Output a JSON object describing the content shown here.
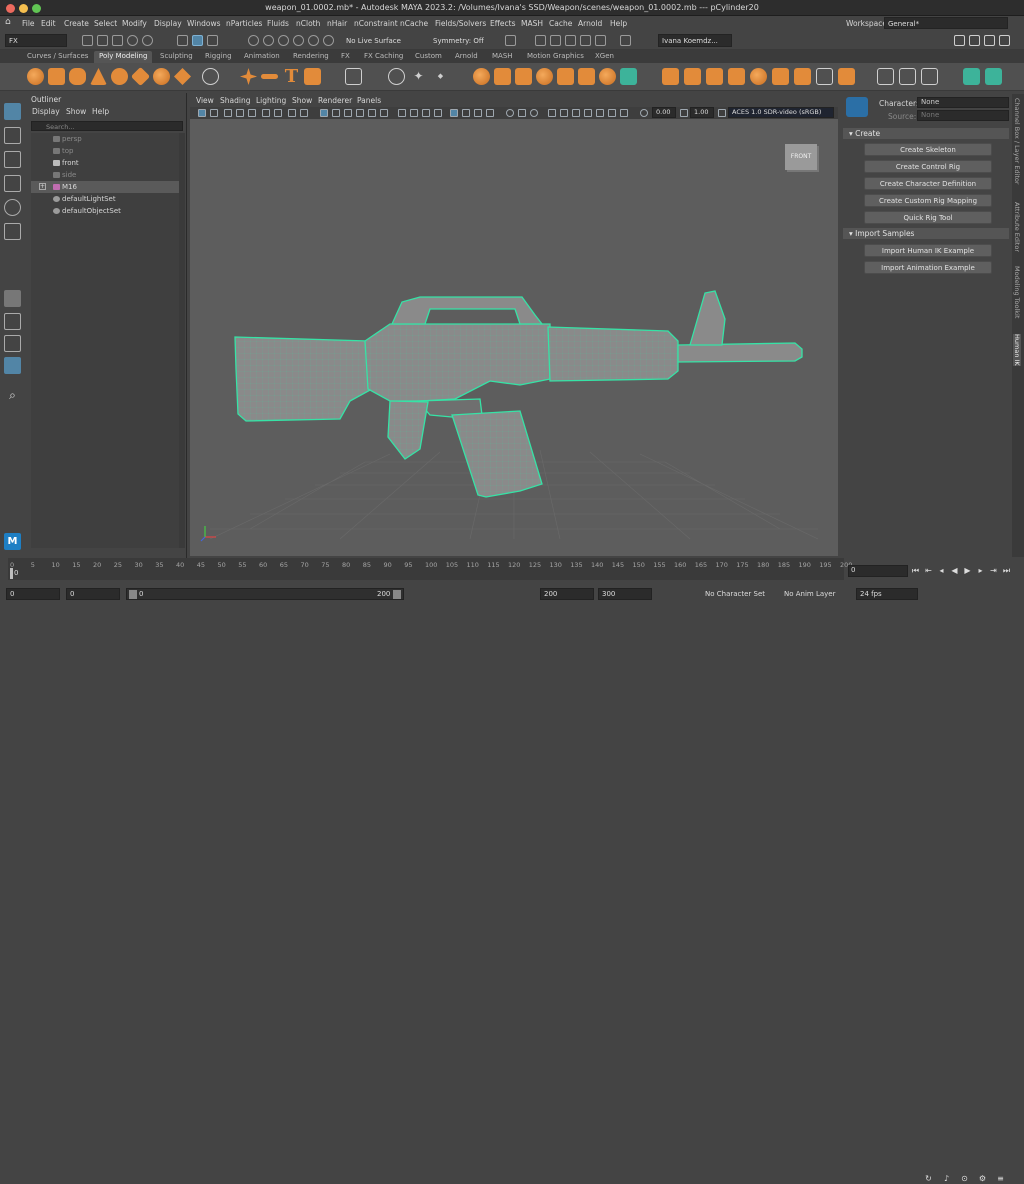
{
  "window": {
    "title": "weapon_01.0002.mb* - Autodesk MAYA 2023.2: /Volumes/Ivana's SSD/Weapon/scenes/weapon_01.0002.mb  ---  pCylinder20"
  },
  "menubar": {
    "items": [
      "File",
      "Edit",
      "Create",
      "Select",
      "Modify",
      "Display",
      "Windows",
      "nParticles",
      "Fluids",
      "nCloth",
      "nHair",
      "nConstraint",
      "nCache",
      "Fields/Solvers",
      "Effects",
      "MASH",
      "Cache",
      "Arnold",
      "Help"
    ],
    "workspace_label": "Workspace:",
    "workspace_value": "General*"
  },
  "statusline": {
    "menuset": "FX",
    "live_surface": "No Live Surface",
    "symmetry": "Symmetry: Off",
    "user": "Ivana Koemdz..."
  },
  "shelf": {
    "tabs": [
      "Curves / Surfaces",
      "Poly Modeling",
      "Sculpting",
      "Rigging",
      "Animation",
      "Rendering",
      "FX",
      "FX Caching",
      "Custom",
      "Arnold",
      "MASH",
      "Motion Graphics",
      "XGen"
    ],
    "active_tab": "Poly Modeling"
  },
  "outliner": {
    "title": "Outliner",
    "menus": [
      "Display",
      "Show",
      "Help"
    ],
    "search_placeholder": "Search...",
    "items": [
      {
        "label": "persp",
        "dim": true
      },
      {
        "label": "top",
        "dim": true
      },
      {
        "label": "front",
        "dim": false
      },
      {
        "label": "side",
        "dim": true
      },
      {
        "label": "M16",
        "dim": false,
        "selected": true
      },
      {
        "label": "defaultLightSet",
        "dim": false
      },
      {
        "label": "defaultObjectSet",
        "dim": false
      }
    ]
  },
  "viewport": {
    "menus": [
      "View",
      "Shading",
      "Lighting",
      "Show",
      "Renderer",
      "Panels"
    ],
    "exposure": "0.00",
    "gamma": "1.00",
    "colorspace": "ACES 1.0 SDR-video (sRGB)",
    "view_cube_label": "FRONT"
  },
  "hik": {
    "character_label": "Character:",
    "character_value": "None",
    "source_label": "Source:",
    "source_value": "None",
    "create_section": "Create",
    "create_buttons": [
      "Create Skeleton",
      "Create Control Rig",
      "Create Character Definition",
      "Create Custom Rig Mapping",
      "Quick Rig Tool"
    ],
    "import_section": "Import Samples",
    "import_buttons": [
      "Import Human IK Example",
      "Import Animation Example"
    ]
  },
  "sidetabs": [
    "Channel Box / Layer Editor",
    "Attribute Editor",
    "Modeling Toolkit",
    "Human IK"
  ],
  "timeline": {
    "ticks": [
      "0",
      "5",
      "10",
      "15",
      "20",
      "25",
      "30",
      "35",
      "40",
      "45",
      "50",
      "55",
      "60",
      "65",
      "70",
      "75",
      "80",
      "85",
      "90",
      "95",
      "100",
      "105",
      "110",
      "115",
      "120",
      "125",
      "130",
      "135",
      "140",
      "145",
      "150",
      "155",
      "160",
      "165",
      "170",
      "175",
      "180",
      "185",
      "190",
      "195",
      "200"
    ],
    "current_frame": "0",
    "current_time": "0"
  },
  "range": {
    "start": "0",
    "playback_start": "0",
    "range_start": "0",
    "range_end": "200",
    "playback_end": "200",
    "end": "300",
    "character_set": "No Character Set",
    "anim_layer": "No Anim Layer",
    "fps": "24 fps"
  },
  "colors": {
    "wire": "#36e3a6",
    "shelf_orange": "#e28b3a",
    "accent_blue": "#5285a6"
  }
}
